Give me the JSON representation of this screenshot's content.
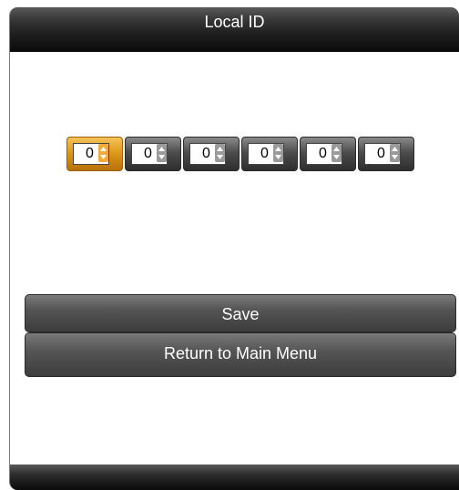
{
  "window": {
    "title": "Local ID"
  },
  "local_id": {
    "digits": [
      "0",
      "0",
      "0",
      "0",
      "0",
      "0"
    ],
    "selected_index": 0
  },
  "buttons": {
    "save_label": "Save",
    "return_label": "Return to Main Menu"
  },
  "colors": {
    "selected_accent": "#e19a1b",
    "bar_dark": "#111111"
  }
}
